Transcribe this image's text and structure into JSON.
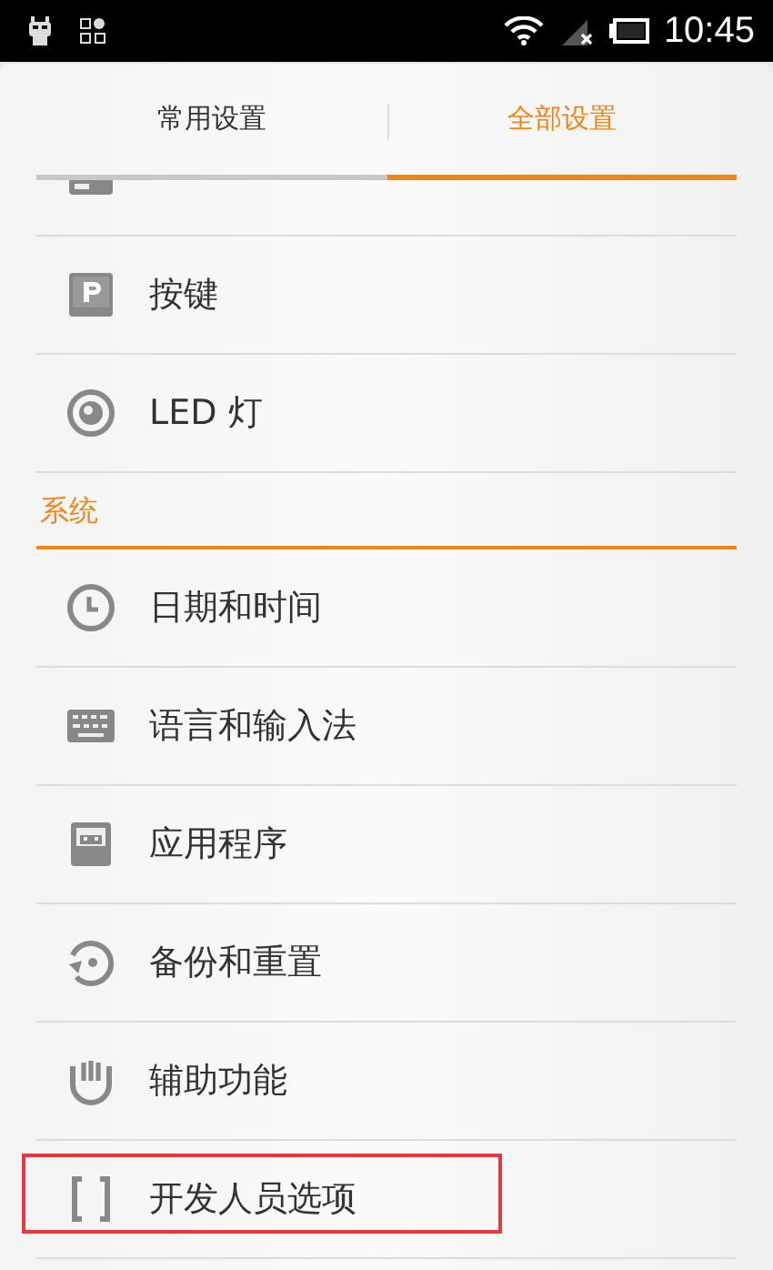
{
  "status_bar": {
    "time": "10:45"
  },
  "tabs": [
    {
      "label": "常用设置",
      "selected": false
    },
    {
      "label": "全部设置",
      "selected": true
    }
  ],
  "list": [
    {
      "kind": "stub"
    },
    {
      "kind": "item",
      "label": "按键",
      "highlighted": false
    },
    {
      "kind": "item",
      "label": "LED 灯",
      "highlighted": false
    },
    {
      "kind": "section",
      "label": "系统"
    },
    {
      "kind": "item",
      "label": "日期和时间",
      "highlighted": false
    },
    {
      "kind": "item",
      "label": "语言和输入法",
      "highlighted": false
    },
    {
      "kind": "item",
      "label": "应用程序",
      "highlighted": false
    },
    {
      "kind": "item",
      "label": "备份和重置",
      "highlighted": false
    },
    {
      "kind": "item",
      "label": "辅助功能",
      "highlighted": false
    },
    {
      "kind": "item",
      "label": "开发人员选项",
      "highlighted": true
    }
  ]
}
